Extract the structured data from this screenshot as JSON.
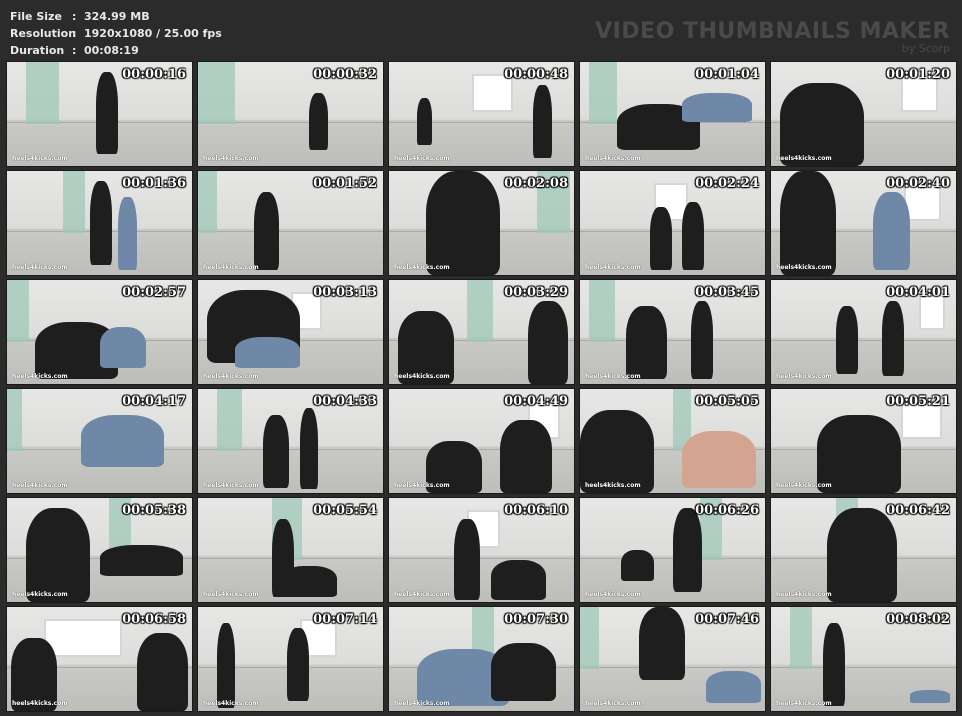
{
  "header": {
    "file_size_label": "File Size",
    "file_size_value": "324.99 MB",
    "resolution_label": "Resolution",
    "resolution_value": "1920x1080 / 25.00 fps",
    "duration_label": "Duration",
    "duration_value": "00:08:19",
    "separator": ":",
    "brand_title": "VIDEO THUMBNAILS MAKER",
    "brand_sub": "by Scorp"
  },
  "watermark": "heels4kicks.com",
  "thumbnails": [
    {
      "time": "00:00:16"
    },
    {
      "time": "00:00:32"
    },
    {
      "time": "00:00:48"
    },
    {
      "time": "00:01:04"
    },
    {
      "time": "00:01:20"
    },
    {
      "time": "00:01:36"
    },
    {
      "time": "00:01:52"
    },
    {
      "time": "00:02:08"
    },
    {
      "time": "00:02:24"
    },
    {
      "time": "00:02:40"
    },
    {
      "time": "00:02:57"
    },
    {
      "time": "00:03:13"
    },
    {
      "time": "00:03:29"
    },
    {
      "time": "00:03:45"
    },
    {
      "time": "00:04:01"
    },
    {
      "time": "00:04:17"
    },
    {
      "time": "00:04:33"
    },
    {
      "time": "00:04:49"
    },
    {
      "time": "00:05:05"
    },
    {
      "time": "00:05:21"
    },
    {
      "time": "00:05:38"
    },
    {
      "time": "00:05:54"
    },
    {
      "time": "00:06:10"
    },
    {
      "time": "00:06:26"
    },
    {
      "time": "00:06:42"
    },
    {
      "time": "00:06:58"
    },
    {
      "time": "00:07:14"
    },
    {
      "time": "00:07:30"
    },
    {
      "time": "00:07:46"
    },
    {
      "time": "00:08:02"
    }
  ]
}
